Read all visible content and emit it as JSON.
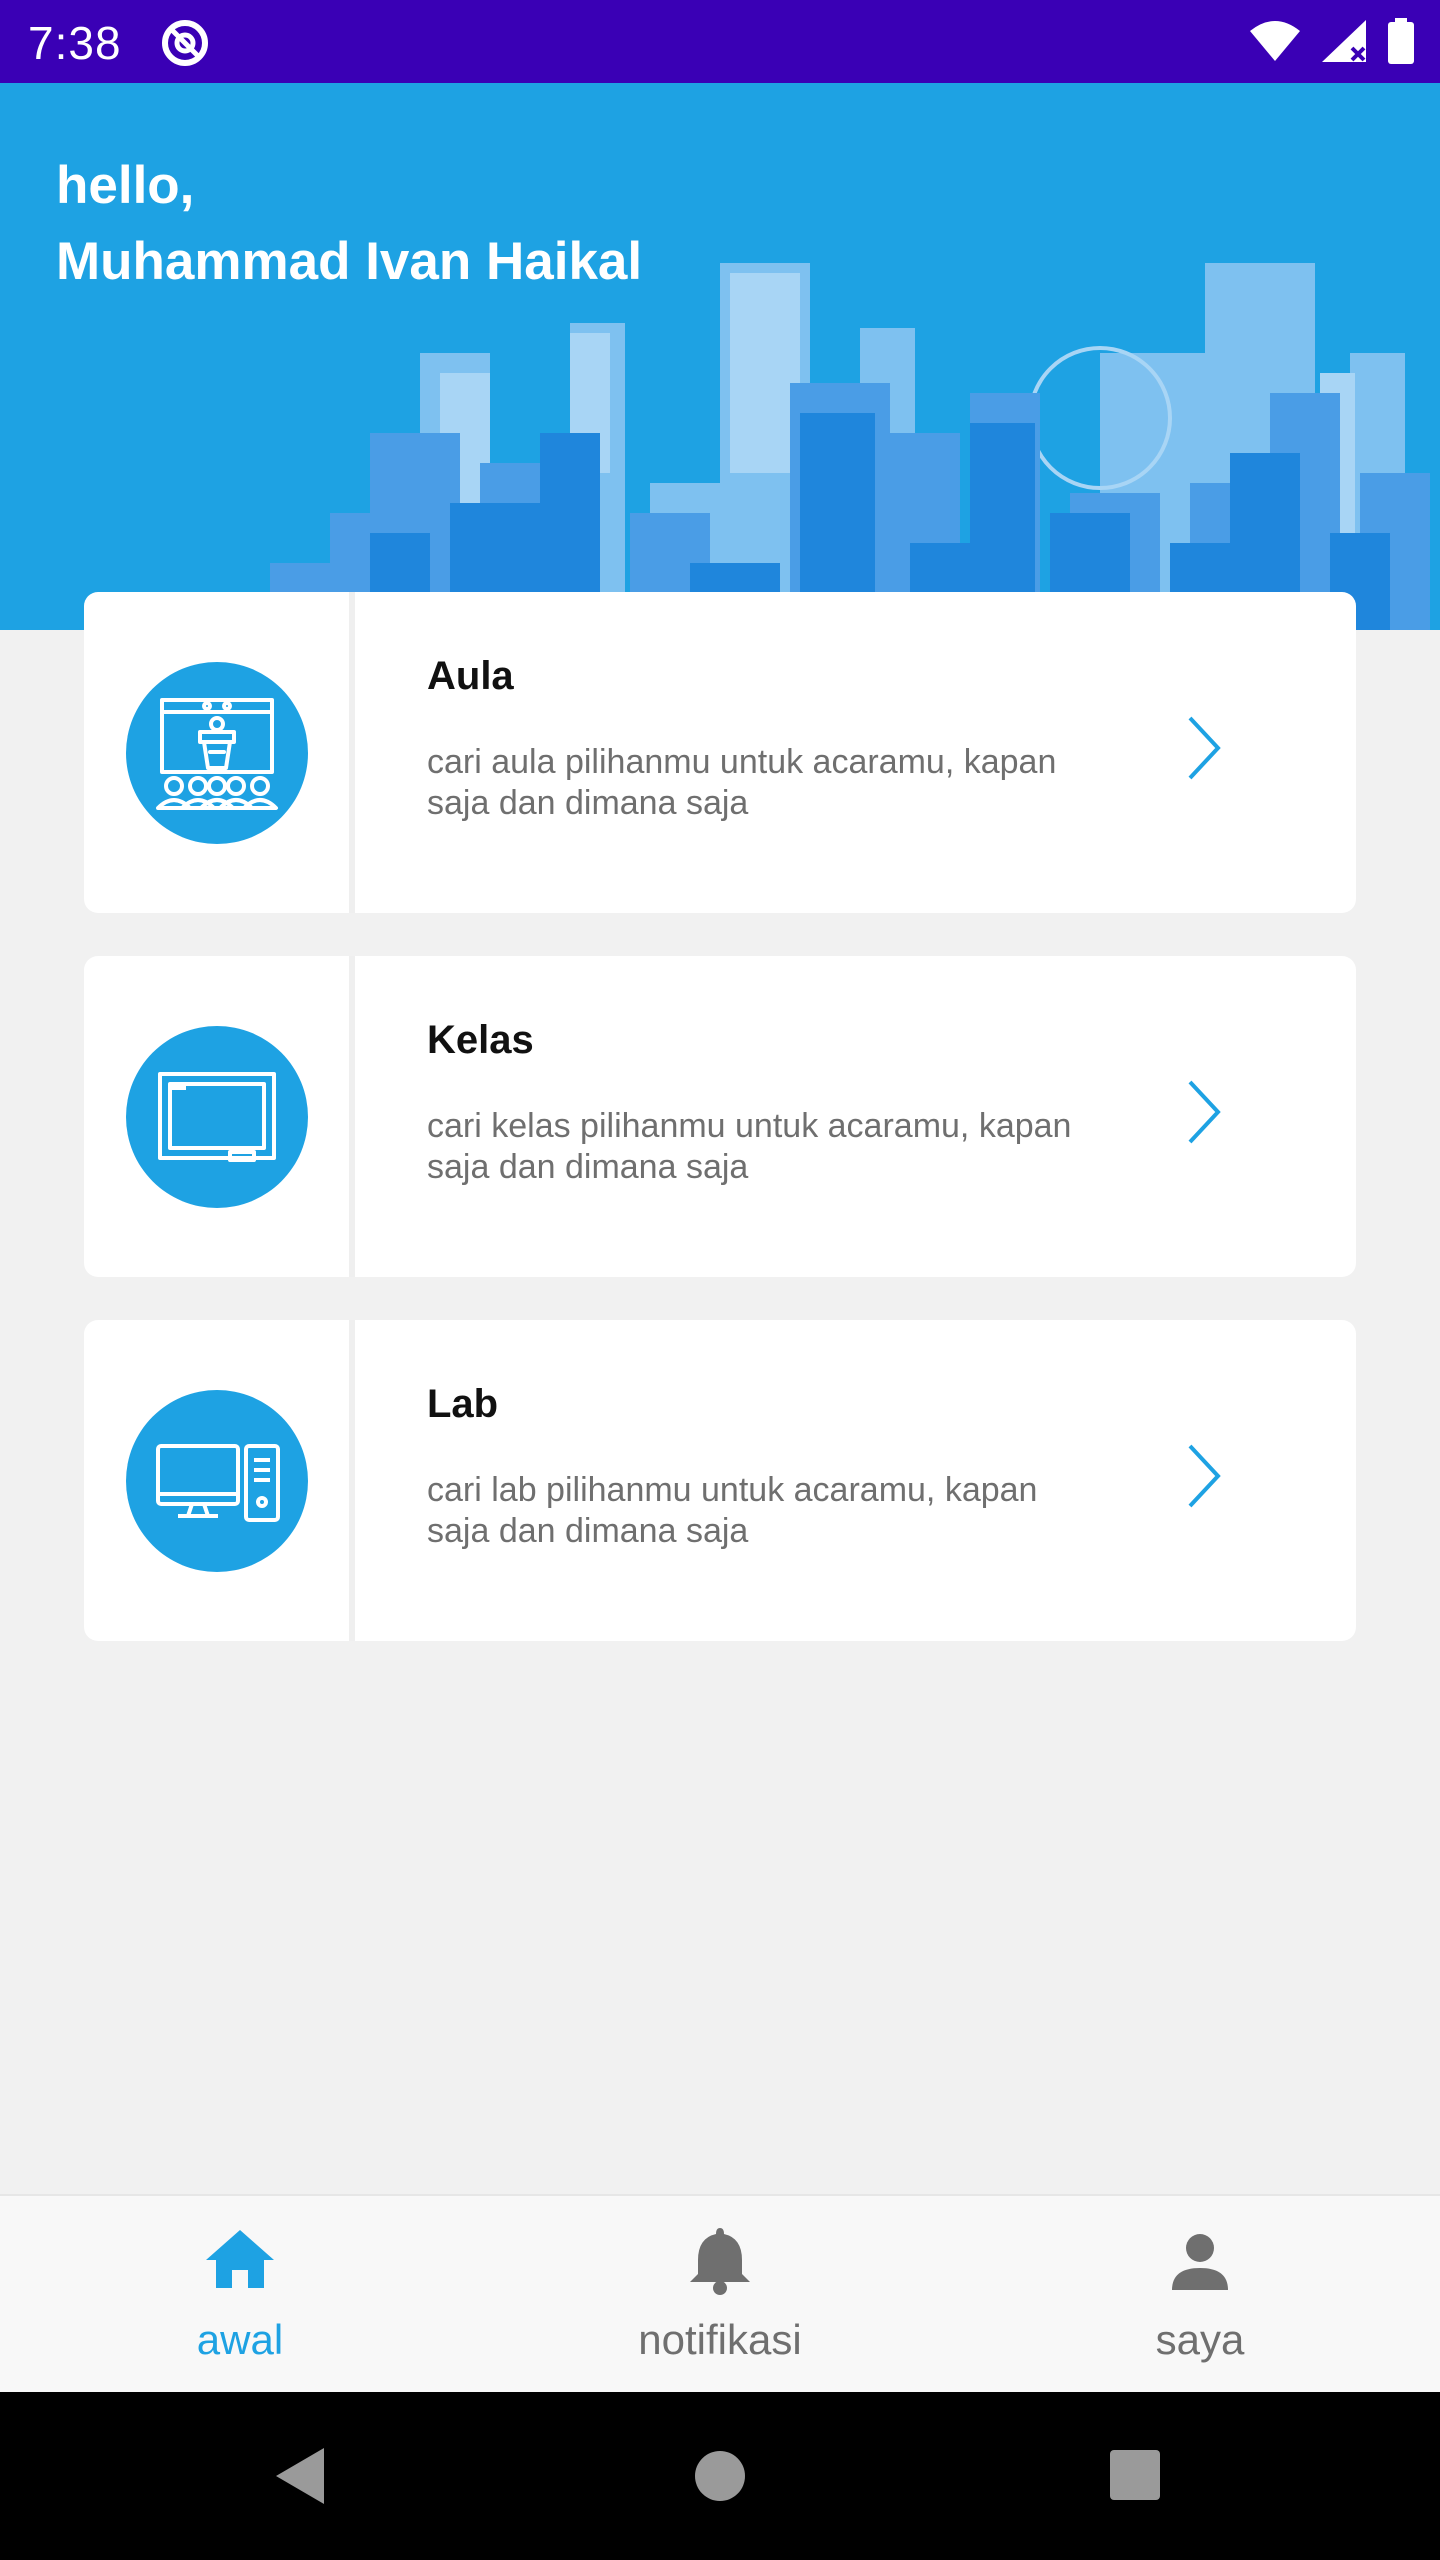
{
  "status_bar": {
    "time": "7:38"
  },
  "header": {
    "greeting": "hello,",
    "user_name": "Muhammad Ivan Haikal"
  },
  "cards": [
    {
      "title": "Aula",
      "description": "cari aula pilihanmu untuk acaramu, kapan saja dan dimana saja",
      "icon": "podium-icon"
    },
    {
      "title": "Kelas",
      "description": "cari kelas pilihanmu untuk acaramu, kapan saja dan dimana saja",
      "icon": "whiteboard-icon"
    },
    {
      "title": "Lab",
      "description": "cari lab pilihanmu untuk acaramu, kapan saja dan dimana saja",
      "icon": "computer-icon"
    }
  ],
  "bottom_nav": {
    "items": [
      {
        "label": "awal",
        "icon": "home-icon",
        "active": true
      },
      {
        "label": "notifikasi",
        "icon": "bell-icon",
        "active": false
      },
      {
        "label": "saya",
        "icon": "person-icon",
        "active": false
      }
    ]
  },
  "colors": {
    "accent": "#1ea2e3",
    "status_bar": "#3a00b5",
    "inactive": "#6f6f6f"
  }
}
